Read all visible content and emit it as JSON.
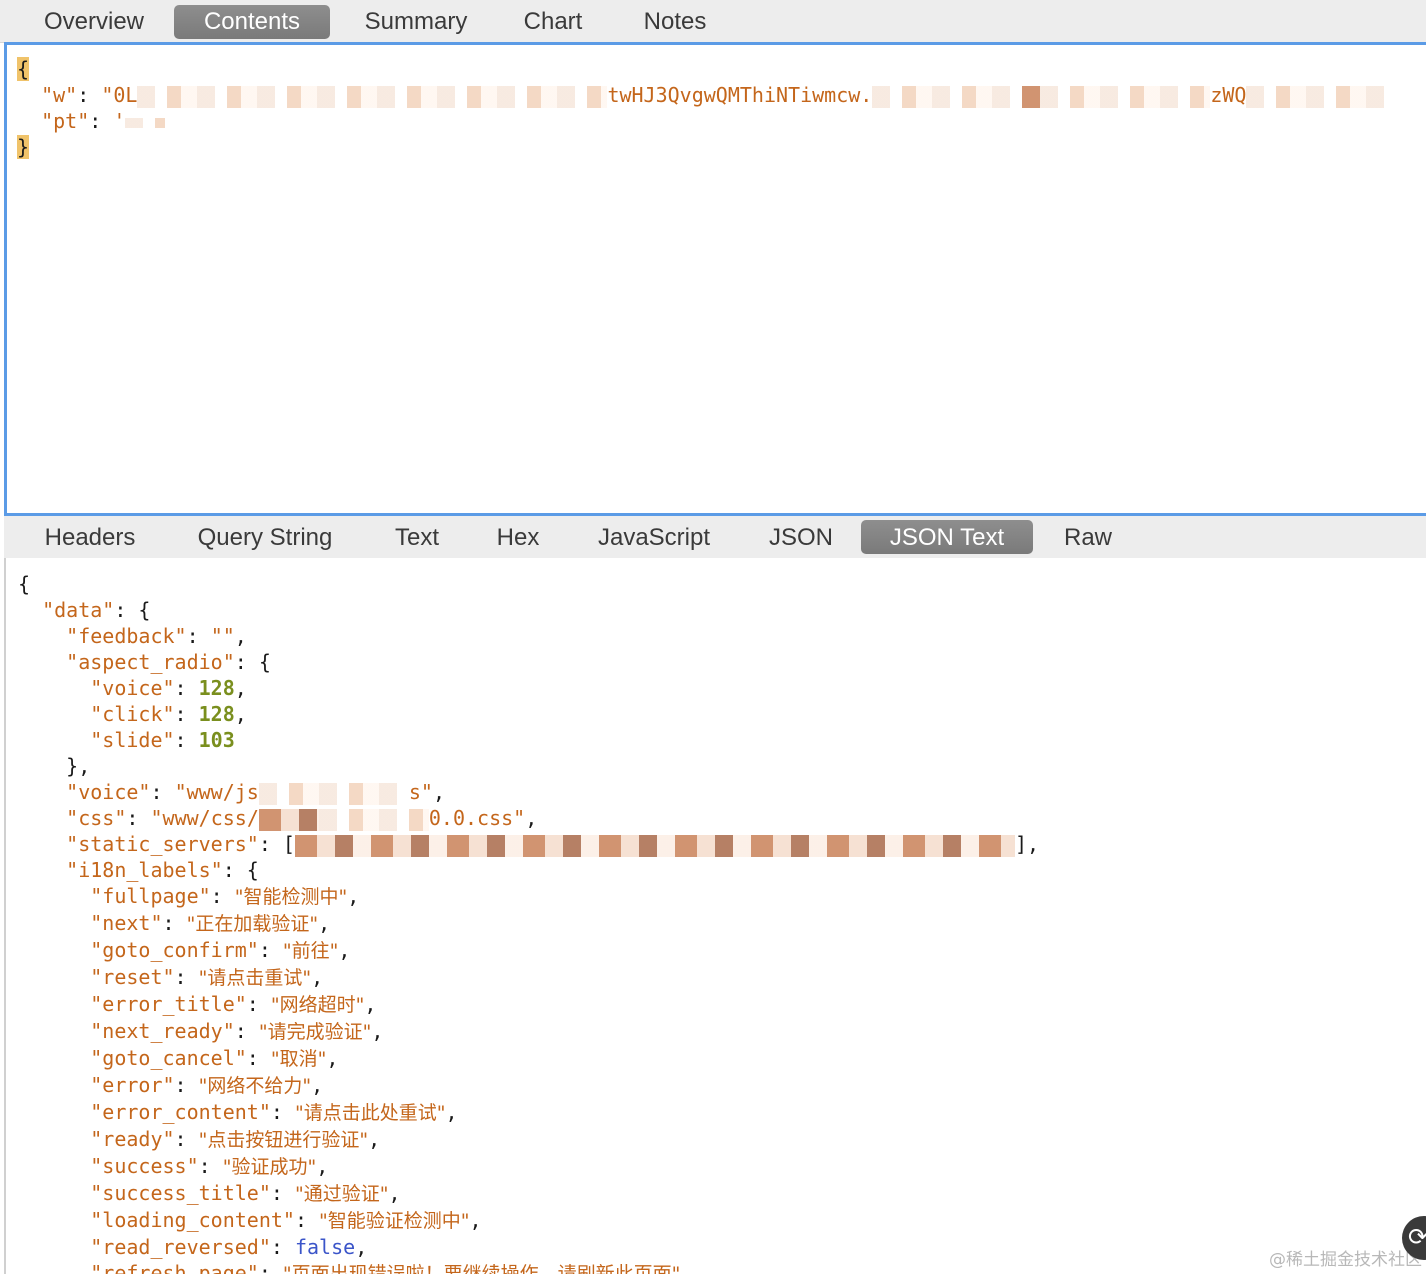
{
  "top_tabs": [
    {
      "label": "Overview"
    },
    {
      "label": "Contents",
      "active": true
    },
    {
      "label": "Summary"
    },
    {
      "label": "Chart"
    },
    {
      "label": "Notes"
    }
  ],
  "request": {
    "open_brace": "{",
    "w_key": "\"w\"",
    "w_value_start": "\"0L",
    "w_value_mid": "twHJ3QvgwQMThiNTiwmcw.",
    "w_value_end": "zWQ",
    "pt_key": "\"pt\"",
    "pt_value": "'",
    "close_brace": "}"
  },
  "response_tabs": [
    {
      "label": "Headers"
    },
    {
      "label": "Query String"
    },
    {
      "label": "Text"
    },
    {
      "label": "Hex"
    },
    {
      "label": "JavaScript"
    },
    {
      "label": "JSON"
    },
    {
      "label": "JSON Text",
      "active": true
    },
    {
      "label": "Raw"
    }
  ],
  "response": {
    "data_key": "\"data\"",
    "feedback_key": "\"feedback\"",
    "feedback_value": "\"\"",
    "aspect_radio_key": "\"aspect_radio\"",
    "voice_num_key": "\"voice\"",
    "voice_num": "128",
    "click_key": "\"click\"",
    "click_num": "128",
    "slide_key": "\"slide\"",
    "slide_num": "103",
    "voice_key": "\"voice\"",
    "voice_value_start": "\"www/js",
    "voice_value_end": "s\"",
    "css_key": "\"css\"",
    "css_value_start": "\"www/css/",
    "css_value_end": "0.0.css\"",
    "static_servers_key": "\"static_servers\"",
    "i18n_key": "\"i18n_labels\"",
    "labels": [
      {
        "key": "\"fullpage\"",
        "value": "\"智能检测中\""
      },
      {
        "key": "\"next\"",
        "value": "\"正在加载验证\""
      },
      {
        "key": "\"goto_confirm\"",
        "value": "\"前往\""
      },
      {
        "key": "\"reset\"",
        "value": "\"请点击重试\""
      },
      {
        "key": "\"error_title\"",
        "value": "\"网络超时\""
      },
      {
        "key": "\"next_ready\"",
        "value": "\"请完成验证\""
      },
      {
        "key": "\"goto_cancel\"",
        "value": "\"取消\""
      },
      {
        "key": "\"error\"",
        "value": "\"网络不给力\""
      },
      {
        "key": "\"error_content\"",
        "value": "\"请点击此处重试\""
      },
      {
        "key": "\"ready\"",
        "value": "\"点击按钮进行验证\""
      },
      {
        "key": "\"success\"",
        "value": "\"验证成功\""
      },
      {
        "key": "\"success_title\"",
        "value": "\"通过验证\""
      },
      {
        "key": "\"loading_content\"",
        "value": "\"智能验证检测中\""
      }
    ],
    "read_reversed_key": "\"read_reversed\"",
    "read_reversed_value": "false",
    "refresh_key": "\"refresh_page\"",
    "refresh_value": "\"页面出现错误啦！要继续操作，请刷新此页面\""
  },
  "watermark": "@稀土掘金技术社区",
  "corner_button": "⟳"
}
